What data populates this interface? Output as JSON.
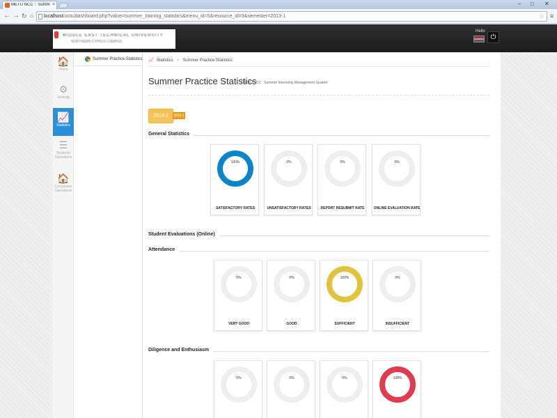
{
  "browser": {
    "tab_title": "METU NCC :: Summer Intern",
    "tab_close": "×",
    "url_host": "localhost",
    "url_path": "/octu/dashboard.php?value=summer_training_statistics&menu_id=5&resource_id=9&semester=2013-1",
    "controls": {
      "minimize": "–",
      "maximize": "□",
      "close": "✕"
    }
  },
  "header": {
    "logo_text_line1": "MIDDLE EAST TECHNICAL UNIVERSITY",
    "logo_text_line2": "NORTHERN CYPRUS CAMPUS",
    "hello": "Hello",
    "power_icon": "⏻"
  },
  "sidebar": {
    "items": [
      {
        "icon": "🏠",
        "label": "Home",
        "active": false
      },
      {
        "icon": "⚙",
        "label": "Settings",
        "active": false
      },
      {
        "icon": "📈",
        "label": "Statistics",
        "active": true
      },
      {
        "icon": "☰",
        "label": "Students Operations",
        "active": false
      },
      {
        "icon": "🏠",
        "label": "Companies Operations",
        "active": false
      }
    ]
  },
  "subnav": {
    "item": "Summer Practice Statistics"
  },
  "breadcrumb": {
    "items": [
      "Statistics",
      "Summer Practice Statistics"
    ]
  },
  "page": {
    "title": "Summer Practice Statistics",
    "subtitle": "METU NCC : Summer Internship Management System"
  },
  "semester": {
    "selected": "2013-1",
    "dropdown": "2013-1"
  },
  "colors": {
    "blue": "#0a85c7",
    "yellow": "#e0c43c",
    "red": "#e23a4e",
    "empty": "#eeeeee",
    "accent": "#2b8fd6"
  },
  "sections": {
    "general": {
      "title": "General Statistics",
      "cards": [
        {
          "value": "100%",
          "label": "SATISFACTORY RATES",
          "fraction": 1,
          "color": "blue"
        },
        {
          "value": "0%",
          "label": "UNSATISFACTORY RATES",
          "fraction": 0,
          "color": "empty"
        },
        {
          "value": "0%",
          "label": "REPORT RESUBMIT RATE",
          "fraction": 0,
          "color": "empty"
        },
        {
          "value": "0%",
          "label": "ONLINE EVALUATION RATE",
          "fraction": 0,
          "color": "empty"
        }
      ]
    },
    "student_evaluations": {
      "title": "Student Evaluations (Online)"
    },
    "attendance": {
      "title": "Attendance",
      "cards": [
        {
          "value": "0%",
          "label": "VERY GOOD",
          "fraction": 0,
          "color": "empty"
        },
        {
          "value": "0%",
          "label": "GOOD",
          "fraction": 0,
          "color": "empty"
        },
        {
          "value": "100%",
          "label": "SUFFICIENT",
          "fraction": 1,
          "color": "yellow"
        },
        {
          "value": "0%",
          "label": "INSUFFICIENT",
          "fraction": 0,
          "color": "empty"
        }
      ]
    },
    "diligence": {
      "title": "Diligence and Enthusiasm",
      "cards": [
        {
          "value": "0%",
          "fraction": 0,
          "color": "empty"
        },
        {
          "value": "0%",
          "fraction": 0,
          "color": "empty"
        },
        {
          "value": "0%",
          "fraction": 0,
          "color": "empty"
        },
        {
          "value": "100%",
          "fraction": 1,
          "color": "red"
        }
      ]
    }
  }
}
